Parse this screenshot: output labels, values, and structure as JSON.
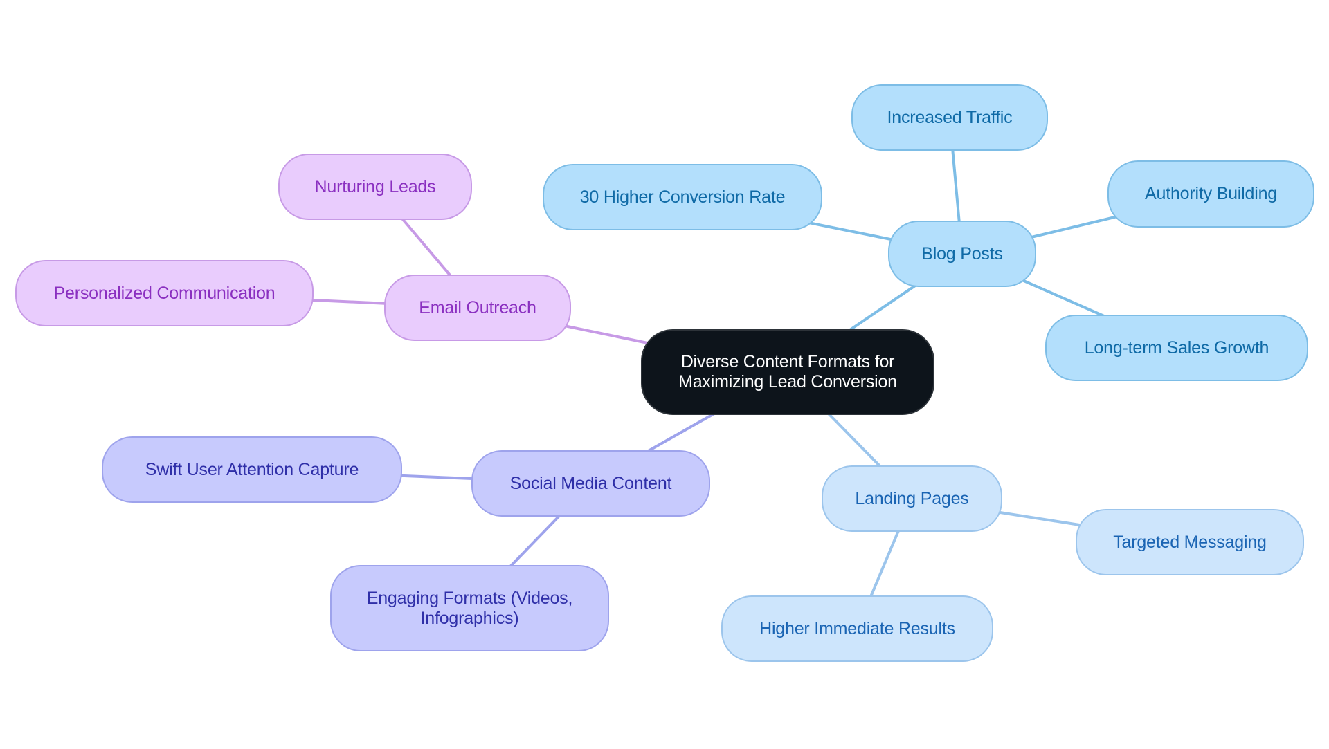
{
  "diagram": {
    "type": "mindmap",
    "root": {
      "id": "root",
      "label": "Diverse Content Formats for Maximizing Lead Conversion",
      "lines": [
        "Diverse Content Formats for",
        "Maximizing Lead Conversion"
      ]
    },
    "branches": [
      {
        "id": "blog",
        "label": "Blog Posts",
        "color": "#7dbde6",
        "children": [
          {
            "id": "blog-c0",
            "label": "Increased Traffic"
          },
          {
            "id": "blog-c1",
            "label": "30 Higher Conversion Rate"
          },
          {
            "id": "blog-c2",
            "label": "Authority Building"
          },
          {
            "id": "blog-c3",
            "label": "Long-term Sales Growth"
          }
        ]
      },
      {
        "id": "landing",
        "label": "Landing Pages",
        "color": "#9cc5ec",
        "children": [
          {
            "id": "landing-c0",
            "label": "Targeted Messaging"
          },
          {
            "id": "landing-c1",
            "label": "Higher Immediate Results"
          }
        ]
      },
      {
        "id": "social",
        "label": "Social Media Content",
        "color": "#9ea3ec",
        "children": [
          {
            "id": "social-c0",
            "label": "Swift User Attention Capture"
          },
          {
            "id": "social-c1",
            "label": "Engaging Formats (Videos, Infographics)",
            "lines": [
              "Engaging Formats (Videos,",
              "Infographics)"
            ]
          }
        ]
      },
      {
        "id": "email",
        "label": "Email Outreach",
        "color": "#c79ae6",
        "children": [
          {
            "id": "email-c0",
            "label": "Nurturing Leads"
          },
          {
            "id": "email-c1",
            "label": "Personalized Communication"
          }
        ]
      }
    ],
    "colors": {
      "root_fill": "#0d141b",
      "blog_fill": "#b3dffc",
      "landing_fill": "#cde5fc",
      "social_fill": "#c7cafd",
      "email_fill": "#e9ccfd"
    }
  }
}
